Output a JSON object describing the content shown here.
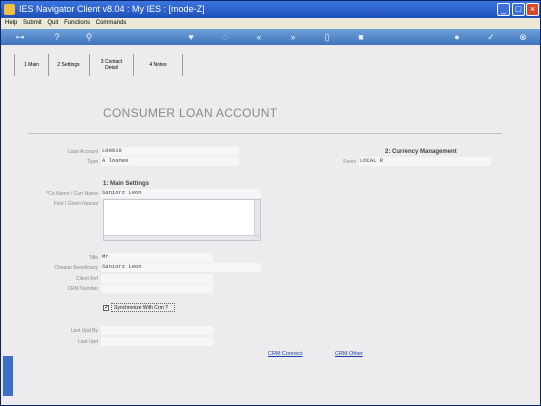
{
  "window": {
    "title": "IES Navigator Client v8.04 : My IES :     [mode-Z]"
  },
  "menu": [
    "Help",
    "Submit",
    "Quit",
    "Functions",
    "Commands"
  ],
  "tabs": [
    {
      "label": "1 Main"
    },
    {
      "label": "2 Settings"
    },
    {
      "label": "3 Contact Detail"
    },
    {
      "label": "4 Notes"
    }
  ],
  "page": {
    "heading": "CONSUMER LOAN ACCOUNT"
  },
  "account": {
    "loan_account_label": "Loan Account",
    "loan_account_value": "L00019",
    "type_label": "Type",
    "type_value": "A loanee"
  },
  "currency": {
    "section_title": "2: Currency Management",
    "forex_label": "Forex",
    "forex_value": "LOCAL R"
  },
  "main_settings": {
    "section_title": "1: Main Settings",
    "co_name_label": "*Co Name / Curr Name",
    "co_name_value": "Saniorz Leon",
    "first_names_label": "First / Given Names",
    "first_names_value": "",
    "title_label": "Title",
    "title_value": "Mr",
    "cheque_label": "Cheque Beneficiary",
    "cheque_value": "Saniorz Leon",
    "client_ref_label": "Client Ref",
    "client_ref_value": "",
    "crm_number_label": "CRM Number",
    "crm_number_value": "",
    "sync_label": "Synchronize With Crm ?",
    "sync_checked": "✓",
    "last_upd_by_label": "Last Upd By",
    "last_upd_by_value": "",
    "last_upd_label": "Last Upd",
    "last_upd_value": ""
  },
  "links": {
    "crm_connect": "CRM Connect",
    "crm_other": "CRM Other"
  },
  "toolbar_icons": [
    "key-icon",
    "help-icon",
    "search-icon",
    "heart-icon",
    "refresh-icon",
    "back-icon",
    "forward-icon",
    "page-icon",
    "stop-icon",
    "info-icon",
    "check-icon",
    "close-icon"
  ]
}
